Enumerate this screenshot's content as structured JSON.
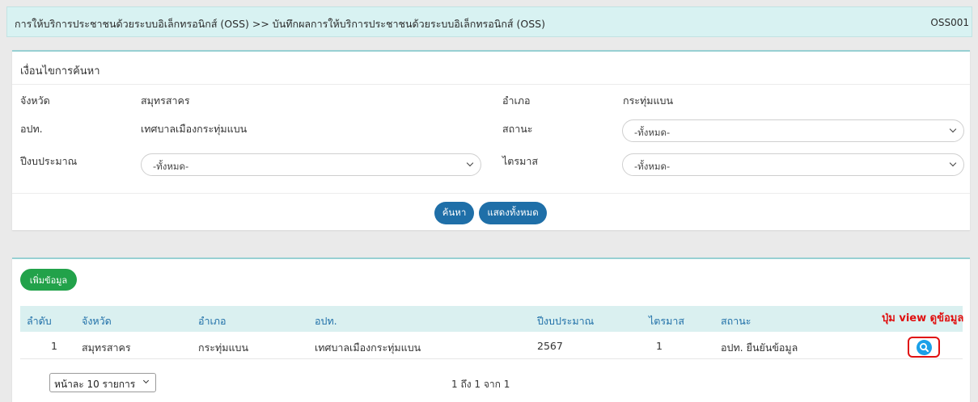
{
  "breadcrumb": {
    "text": "การให้บริการประชาชนด้วยระบบอิเล็กทรอนิกส์ (OSS) >> บันทึกผลการให้บริการประชาชนด้วยระบบอิเล็กทรอนิกส์ (OSS)",
    "code": "OSS001"
  },
  "search": {
    "title": "เงื่อนไขการค้นหา",
    "province_label": "จังหวัด",
    "province_value": "สมุทรสาคร",
    "district_label": "อำเภอ",
    "district_value": "กระทุ่มแบน",
    "org_label": "อปท.",
    "org_value": "เทศบาลเมืองกระทุ่มแบน",
    "status_label": "สถานะ",
    "status_selected": "-ทั้งหมด-",
    "year_label": "ปีงบประมาณ",
    "year_selected": "-ทั้งหมด-",
    "quarter_label": "ไตรมาส",
    "quarter_selected": "-ทั้งหมด-",
    "search_button": "ค้นหา",
    "show_all_button": "แสดงทั้งหมด"
  },
  "list": {
    "add_button": "เพิ่มข้อมูล",
    "columns": [
      "ลำดับ",
      "จังหวัด",
      "อำเภอ",
      "อปท.",
      "ปีงบประมาณ",
      "ไตรมาส",
      "สถานะ"
    ],
    "rows": [
      [
        "1",
        "สมุทรสาคร",
        "กระทุ่มแบน",
        "เทศบาลเมืองกระทุ่มแบน",
        "2567",
        "1",
        "อปท. ยืนยันข้อมูล"
      ]
    ],
    "view_icon": "search-icon",
    "annotation": "ปุ่ม view ดูข้อมูล",
    "page_size": "หน้าละ 10 รายการ",
    "page_info": "1 ถึง 1 จาก 1"
  },
  "colors": {
    "header_bg": "#d8f2f2",
    "primary": "#1f6fa8",
    "add_green": "#22a24a",
    "view_blue": "#1aa0e8",
    "annotation_red": "#e01010"
  }
}
